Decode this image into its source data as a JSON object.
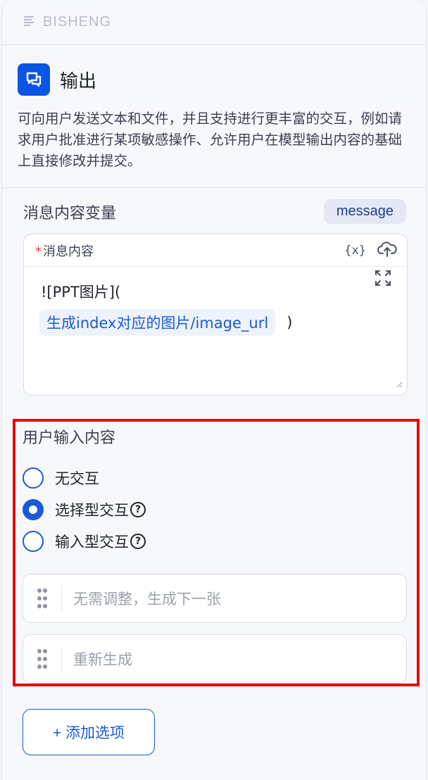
{
  "brand": {
    "name": "BISHENG"
  },
  "node": {
    "title": "输出",
    "icon": "chat-bubble-icon",
    "description": "可向用户发送文本和文件，并且支持进行更丰富的交互，例如请求用户批准进行某项敏感操作、允许用户在模型输出内容的基础上直接修改并提交。"
  },
  "message_variable": {
    "label": "消息内容变量",
    "tag": "message"
  },
  "message_content": {
    "required_mark": "*",
    "label": "消息内容",
    "var_button": "{x}",
    "text_prefix": "![PPT图片](",
    "variable_chip": "生成index对应的图片/image_url",
    "text_suffix": ")"
  },
  "user_input": {
    "label": "用户输入内容",
    "options": [
      {
        "label": "无交互",
        "checked": false,
        "help": false
      },
      {
        "label": "选择型交互",
        "checked": true,
        "help": true
      },
      {
        "label": "输入型交互",
        "checked": false,
        "help": true
      }
    ],
    "help_glyph": "?",
    "choices": [
      {
        "placeholder": "无需调整，生成下一张"
      },
      {
        "placeholder": "重新生成"
      }
    ]
  },
  "add_button": {
    "label": "+ 添加选项"
  },
  "colors": {
    "accent": "#1a5ad8",
    "highlight": "#e8000b",
    "icon_bg": "#0a55e4"
  }
}
